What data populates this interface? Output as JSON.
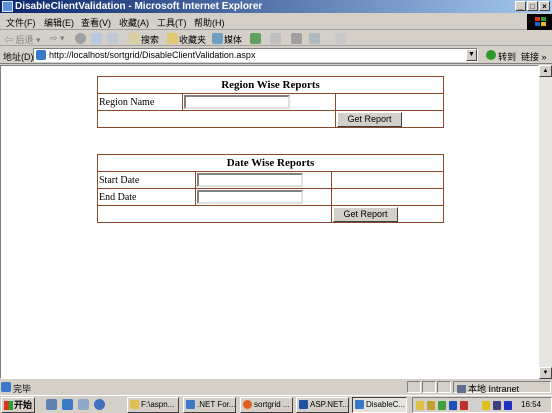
{
  "window": {
    "title": "DisableClientValidation - Microsoft Internet Explorer",
    "controls": [
      "_",
      "□",
      "×"
    ]
  },
  "menu": [
    "文件(F)",
    "编辑(E)",
    "查看(V)",
    "收藏(A)",
    "工具(T)",
    "帮助(H)"
  ],
  "toolbar": {
    "back": "后退",
    "search": "搜索",
    "favorites": "收藏夹",
    "media": "媒体"
  },
  "address": {
    "label": "地址(D)",
    "url": "http://localhost/sortgrid/DisableClientValidation.aspx",
    "go": "转到",
    "links": "链接 »"
  },
  "region_report": {
    "header": "Region Wise Reports",
    "field_label": "Region Name",
    "field_value": "",
    "button": "Get Report"
  },
  "date_report": {
    "header": "Date Wise Reports",
    "start_label": "Start Date",
    "start_value": "",
    "end_label": "End Date",
    "end_value": "",
    "button": "Get Report"
  },
  "status": {
    "text": "完毕",
    "zone": "本地 Intranet"
  },
  "taskbar": {
    "start": "开始",
    "tasks": [
      "F:\\aspn...",
      ".NET For...",
      "sortgrid ...",
      "ASP.NET...",
      "DisableC..."
    ],
    "clock": "16:54"
  }
}
